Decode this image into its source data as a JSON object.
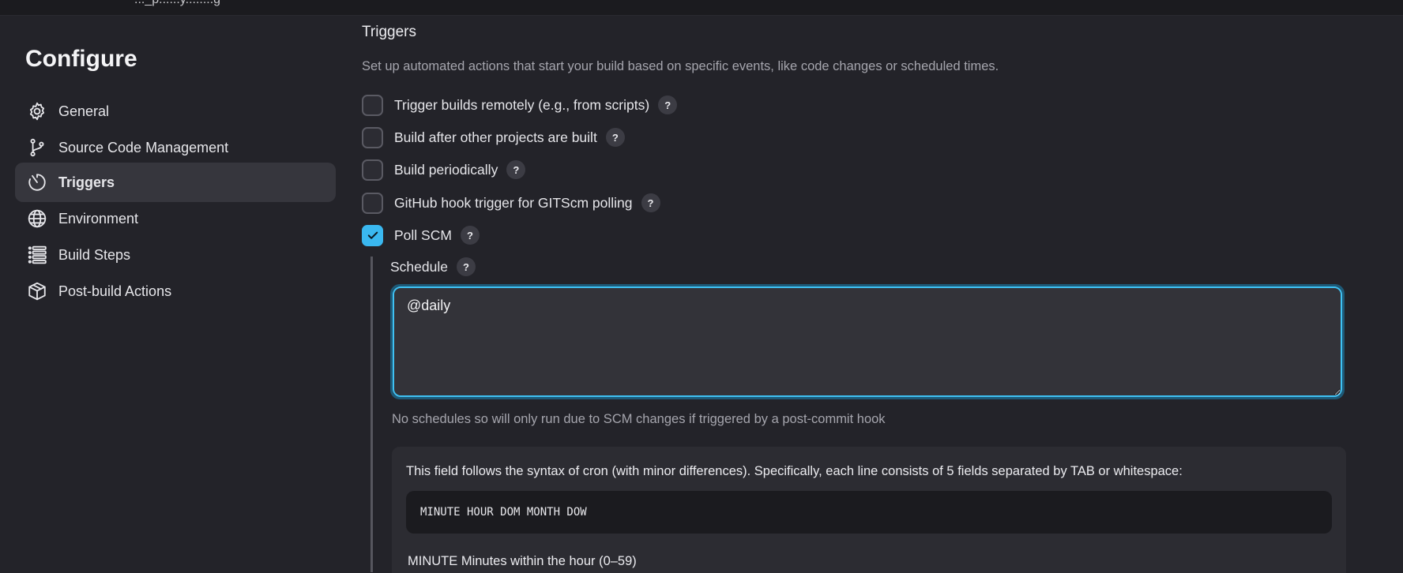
{
  "topbar": {
    "crumb": "..._p......y........g"
  },
  "sidebar": {
    "title": "Configure",
    "items": [
      {
        "label": "General",
        "icon": "gear-icon"
      },
      {
        "label": "Source Code Management",
        "icon": "git-branch-icon"
      },
      {
        "label": "Triggers",
        "icon": "timer-icon",
        "active": true
      },
      {
        "label": "Environment",
        "icon": "globe-icon"
      },
      {
        "label": "Build Steps",
        "icon": "list-icon"
      },
      {
        "label": "Post-build Actions",
        "icon": "package-icon"
      }
    ]
  },
  "main": {
    "title": "Triggers",
    "description": "Set up automated actions that start your build based on specific events, like code changes or scheduled times.",
    "options": [
      {
        "label": "Trigger builds remotely (e.g., from scripts)",
        "checked": false
      },
      {
        "label": "Build after other projects are built",
        "checked": false
      },
      {
        "label": "Build periodically",
        "checked": false
      },
      {
        "label": "GitHub hook trigger for GITScm polling",
        "checked": false
      },
      {
        "label": "Poll SCM",
        "checked": true
      }
    ],
    "help_symbol": "?",
    "schedule": {
      "label": "Schedule",
      "value": "@daily",
      "hint": "No schedules so will only run due to SCM changes if triggered by a post-commit hook"
    },
    "info": {
      "text": "This field follows the syntax of cron (with minor differences). Specifically, each line consists of 5 fields separated by TAB or whitespace:",
      "code": "MINUTE HOUR DOM MONTH DOW",
      "minute_line": "MINUTE Minutes within the hour (0–59)"
    }
  },
  "colors": {
    "accent": "#3ab8f0",
    "background": "#232329",
    "active_item": "#36363d"
  }
}
